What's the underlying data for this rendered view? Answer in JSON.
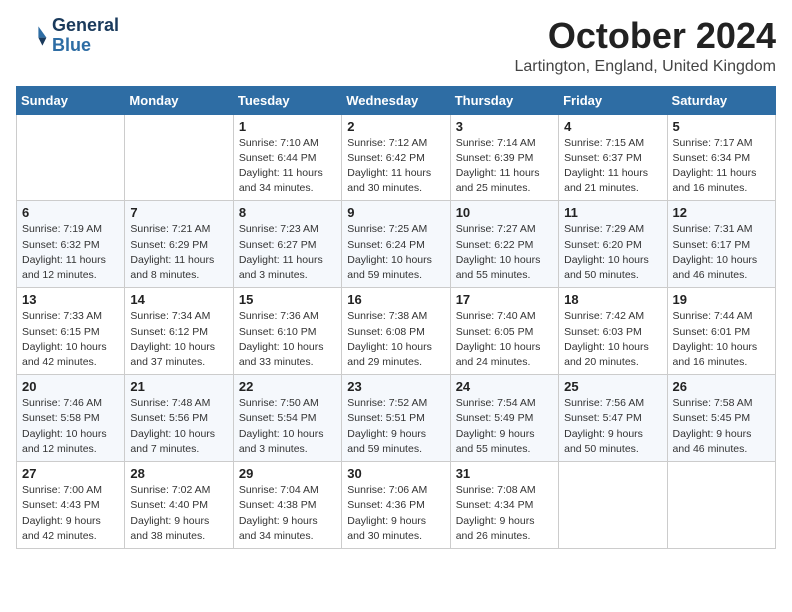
{
  "header": {
    "logo_line1": "General",
    "logo_line2": "Blue",
    "month": "October 2024",
    "location": "Lartington, England, United Kingdom"
  },
  "weekdays": [
    "Sunday",
    "Monday",
    "Tuesday",
    "Wednesday",
    "Thursday",
    "Friday",
    "Saturday"
  ],
  "weeks": [
    [
      {
        "day": "",
        "info": ""
      },
      {
        "day": "",
        "info": ""
      },
      {
        "day": "1",
        "info": "Sunrise: 7:10 AM\nSunset: 6:44 PM\nDaylight: 11 hours and 34 minutes."
      },
      {
        "day": "2",
        "info": "Sunrise: 7:12 AM\nSunset: 6:42 PM\nDaylight: 11 hours and 30 minutes."
      },
      {
        "day": "3",
        "info": "Sunrise: 7:14 AM\nSunset: 6:39 PM\nDaylight: 11 hours and 25 minutes."
      },
      {
        "day": "4",
        "info": "Sunrise: 7:15 AM\nSunset: 6:37 PM\nDaylight: 11 hours and 21 minutes."
      },
      {
        "day": "5",
        "info": "Sunrise: 7:17 AM\nSunset: 6:34 PM\nDaylight: 11 hours and 16 minutes."
      }
    ],
    [
      {
        "day": "6",
        "info": "Sunrise: 7:19 AM\nSunset: 6:32 PM\nDaylight: 11 hours and 12 minutes."
      },
      {
        "day": "7",
        "info": "Sunrise: 7:21 AM\nSunset: 6:29 PM\nDaylight: 11 hours and 8 minutes."
      },
      {
        "day": "8",
        "info": "Sunrise: 7:23 AM\nSunset: 6:27 PM\nDaylight: 11 hours and 3 minutes."
      },
      {
        "day": "9",
        "info": "Sunrise: 7:25 AM\nSunset: 6:24 PM\nDaylight: 10 hours and 59 minutes."
      },
      {
        "day": "10",
        "info": "Sunrise: 7:27 AM\nSunset: 6:22 PM\nDaylight: 10 hours and 55 minutes."
      },
      {
        "day": "11",
        "info": "Sunrise: 7:29 AM\nSunset: 6:20 PM\nDaylight: 10 hours and 50 minutes."
      },
      {
        "day": "12",
        "info": "Sunrise: 7:31 AM\nSunset: 6:17 PM\nDaylight: 10 hours and 46 minutes."
      }
    ],
    [
      {
        "day": "13",
        "info": "Sunrise: 7:33 AM\nSunset: 6:15 PM\nDaylight: 10 hours and 42 minutes."
      },
      {
        "day": "14",
        "info": "Sunrise: 7:34 AM\nSunset: 6:12 PM\nDaylight: 10 hours and 37 minutes."
      },
      {
        "day": "15",
        "info": "Sunrise: 7:36 AM\nSunset: 6:10 PM\nDaylight: 10 hours and 33 minutes."
      },
      {
        "day": "16",
        "info": "Sunrise: 7:38 AM\nSunset: 6:08 PM\nDaylight: 10 hours and 29 minutes."
      },
      {
        "day": "17",
        "info": "Sunrise: 7:40 AM\nSunset: 6:05 PM\nDaylight: 10 hours and 24 minutes."
      },
      {
        "day": "18",
        "info": "Sunrise: 7:42 AM\nSunset: 6:03 PM\nDaylight: 10 hours and 20 minutes."
      },
      {
        "day": "19",
        "info": "Sunrise: 7:44 AM\nSunset: 6:01 PM\nDaylight: 10 hours and 16 minutes."
      }
    ],
    [
      {
        "day": "20",
        "info": "Sunrise: 7:46 AM\nSunset: 5:58 PM\nDaylight: 10 hours and 12 minutes."
      },
      {
        "day": "21",
        "info": "Sunrise: 7:48 AM\nSunset: 5:56 PM\nDaylight: 10 hours and 7 minutes."
      },
      {
        "day": "22",
        "info": "Sunrise: 7:50 AM\nSunset: 5:54 PM\nDaylight: 10 hours and 3 minutes."
      },
      {
        "day": "23",
        "info": "Sunrise: 7:52 AM\nSunset: 5:51 PM\nDaylight: 9 hours and 59 minutes."
      },
      {
        "day": "24",
        "info": "Sunrise: 7:54 AM\nSunset: 5:49 PM\nDaylight: 9 hours and 55 minutes."
      },
      {
        "day": "25",
        "info": "Sunrise: 7:56 AM\nSunset: 5:47 PM\nDaylight: 9 hours and 50 minutes."
      },
      {
        "day": "26",
        "info": "Sunrise: 7:58 AM\nSunset: 5:45 PM\nDaylight: 9 hours and 46 minutes."
      }
    ],
    [
      {
        "day": "27",
        "info": "Sunrise: 7:00 AM\nSunset: 4:43 PM\nDaylight: 9 hours and 42 minutes."
      },
      {
        "day": "28",
        "info": "Sunrise: 7:02 AM\nSunset: 4:40 PM\nDaylight: 9 hours and 38 minutes."
      },
      {
        "day": "29",
        "info": "Sunrise: 7:04 AM\nSunset: 4:38 PM\nDaylight: 9 hours and 34 minutes."
      },
      {
        "day": "30",
        "info": "Sunrise: 7:06 AM\nSunset: 4:36 PM\nDaylight: 9 hours and 30 minutes."
      },
      {
        "day": "31",
        "info": "Sunrise: 7:08 AM\nSunset: 4:34 PM\nDaylight: 9 hours and 26 minutes."
      },
      {
        "day": "",
        "info": ""
      },
      {
        "day": "",
        "info": ""
      }
    ]
  ]
}
